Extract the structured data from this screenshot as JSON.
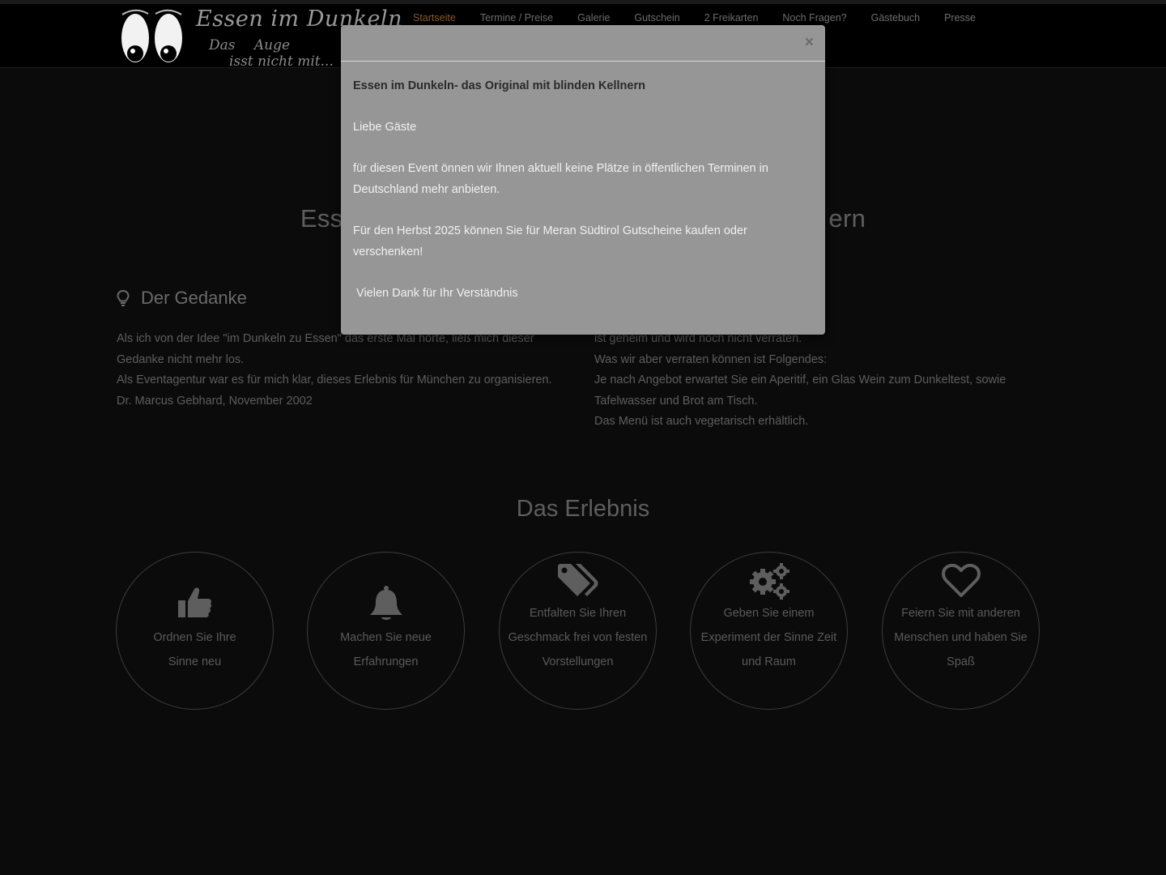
{
  "header": {
    "logo_title": "Essen im Dunkeln",
    "logo_sub_1": "Das Auge",
    "logo_sub_2": "isst nicht mit...",
    "nav": [
      {
        "label": "Startseite",
        "active": true
      },
      {
        "label": "Termine / Preise"
      },
      {
        "label": "Galerie"
      },
      {
        "label": "Gutschein"
      },
      {
        "label": "2 Freikarten"
      },
      {
        "label": "Noch Fragen?"
      },
      {
        "label": "Gästebuch"
      },
      {
        "label": "Presse"
      }
    ]
  },
  "hero": {
    "title_left": "Ess",
    "title_right": "ern"
  },
  "left_col": {
    "heading": "Der Gedanke",
    "icon": "lightbulb-icon",
    "lines": [
      "Als ich von der Idee \"im Dunkeln zu Essen\" das erste Mal hörte, ließ mich dieser",
      "Gedanke nicht mehr los.",
      "Als Eventagentur war es für mich klar, dieses Erlebnis für München zu organisieren.",
      "Dr. Marcus Gebhard, November 2002"
    ]
  },
  "right_col": {
    "lines": [
      "ist geheim und wird noch nicht verraten.",
      "Was wir aber verraten können ist Folgendes:",
      "Je nach Angebot erwartet Sie ein Aperitif, ein Glas Wein zum Dunkeltest, sowie",
      "Tafelwasser und Brot am Tisch.",
      "Das Menü ist auch vegetarisch erhältlich."
    ]
  },
  "erlebnis": {
    "title": "Das Erlebnis",
    "items": [
      {
        "icon": "thumbs-up-icon",
        "lines": [
          "Ordnen Sie Ihre",
          "Sinne neu"
        ]
      },
      {
        "icon": "bell-icon",
        "lines": [
          "Machen Sie neue",
          "Erfahrungen"
        ]
      },
      {
        "icon": "tags-icon",
        "lines": [
          "Entfalten Sie Ihren",
          "Geschmack frei von festen",
          "Vorstellungen"
        ]
      },
      {
        "icon": "gears-icon",
        "lines": [
          "Geben Sie einem",
          "Experiment der Sinne Zeit",
          "und Raum"
        ]
      },
      {
        "icon": "heart-icon",
        "lines": [
          "Feiern Sie mit anderen",
          "Menschen und haben Sie",
          "Spaß"
        ]
      }
    ]
  },
  "modal": {
    "close": "×",
    "title": "Essen im Dunkeln- das Original mit blinden Kellnern",
    "greeting": "Liebe Gäste",
    "para1": "für diesen Event önnen wir Ihnen aktuell keine Plätze in öffentlichen Terminen in Deutschland mehr anbieten.",
    "para2": "Für den Herbst 2025 können Sie für Meran Südtirol Gutscheine  kaufen oder verschenken!",
    "thanks": " Vielen Dank für Ihr Verständnis"
  },
  "colors": {
    "background": "#0b0b0b",
    "modal_bg": "#969696",
    "nav_active": "#8c5a2c"
  }
}
